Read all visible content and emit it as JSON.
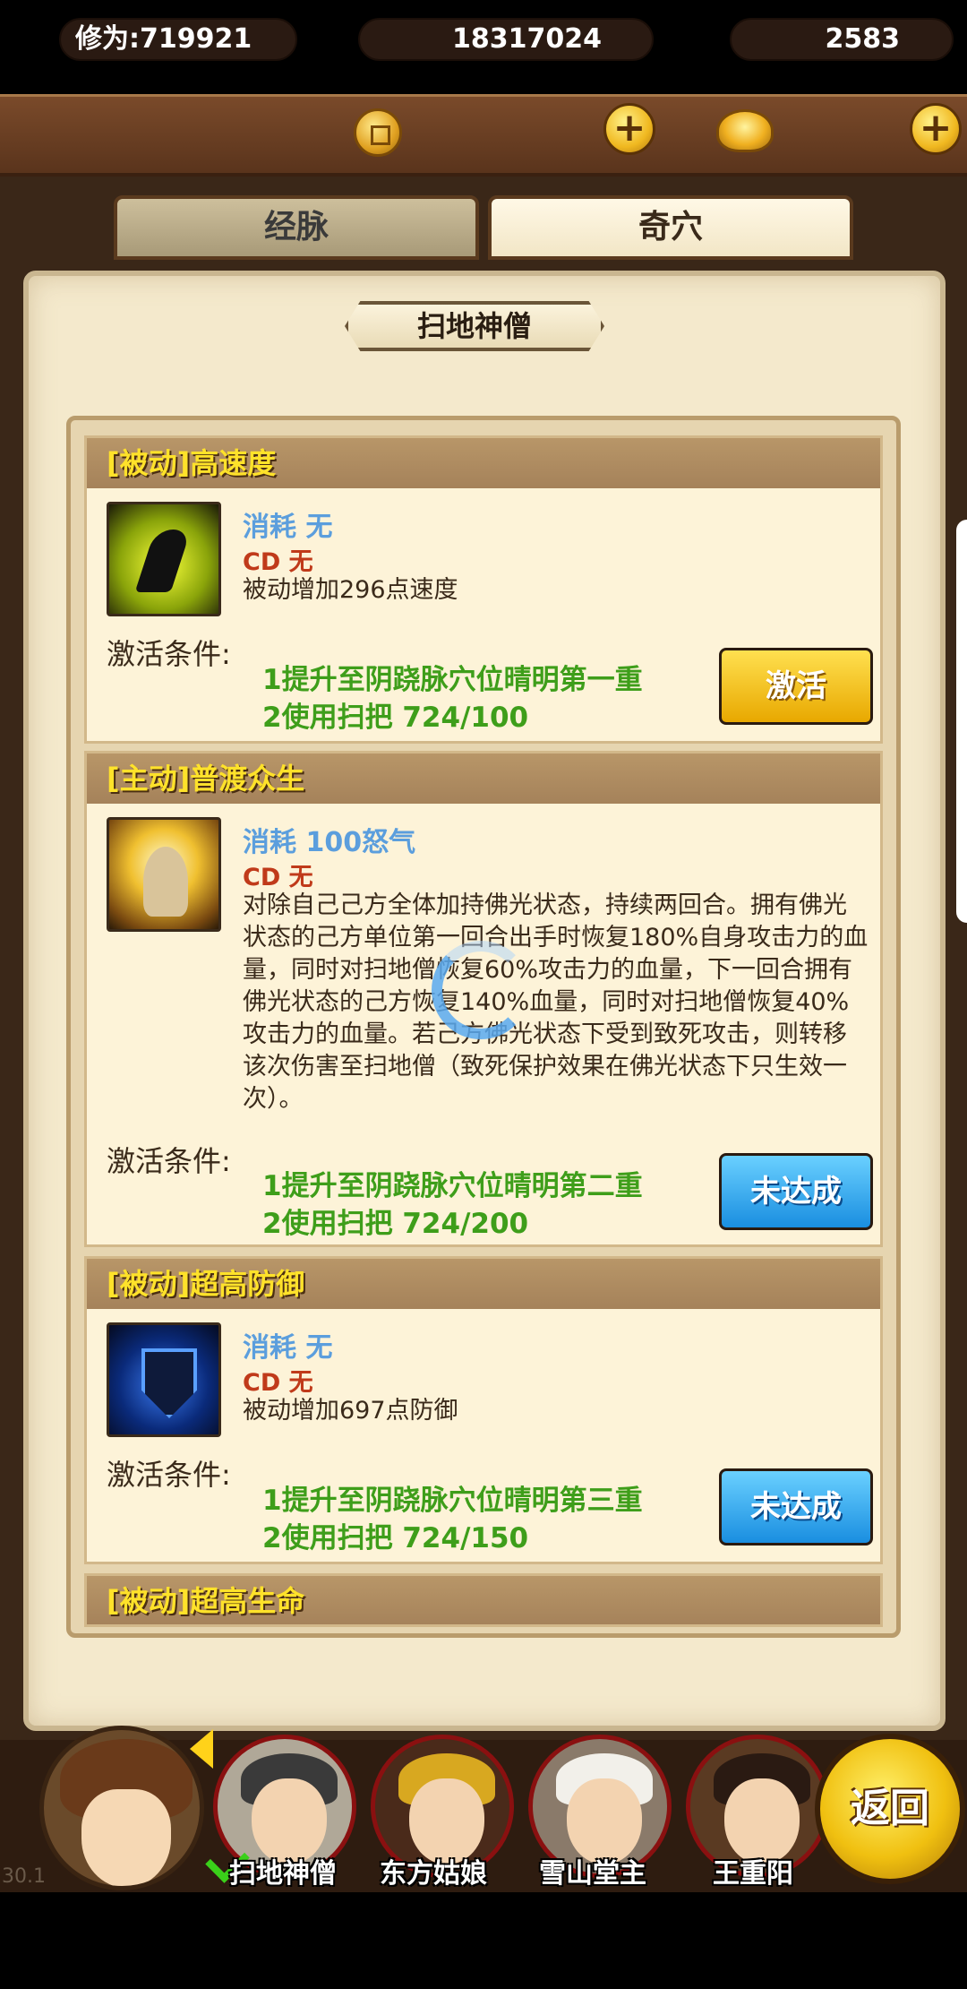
{
  "resources": {
    "cultivation": "修为:719921",
    "coins": "18317024",
    "gold": "2583",
    "plus": "+"
  },
  "tabs": {
    "meridian": "经脉",
    "acupoint": "奇穴"
  },
  "hero_title": "扫地神僧",
  "skills": [
    {
      "header": "[被动]高速度",
      "cost": "消耗 无",
      "cd": "CD   无",
      "desc": "被动增加296点速度",
      "activate_label": "激活条件:",
      "cond1": "1提升至阴跷脉穴位晴明第一重",
      "cond2": "2使用扫把 724/100",
      "button": "激活"
    },
    {
      "header": "[主动]普渡众生",
      "cost": "消耗 100怒气",
      "cd": "CD   无",
      "desc": "对除自己己方全体加持佛光状态，持续两回合。拥有佛光状态的己方单位第一回合出手时恢复180%自身攻击力的血量，同时对扫地僧恢复60%攻击力的血量，下一回合拥有佛光状态的己方恢复140%血量，同时对扫地僧恢复40%攻击力的血量。若己方佛光状态下受到致死攻击，则转移该次伤害至扫地僧（致死保护效果在佛光状态下只生效一次）。",
      "activate_label": "激活条件:",
      "cond1": "1提升至阴跷脉穴位晴明第二重",
      "cond2": "2使用扫把 724/200",
      "button": "未达成"
    },
    {
      "header": "[被动]超高防御",
      "cost": "消耗 无",
      "cd": "CD   无",
      "desc": "被动增加697点防御",
      "activate_label": "激活条件:",
      "cond1": "1提升至阴跷脉穴位晴明第三重",
      "cond2": "2使用扫把 724/150",
      "button": "未达成"
    },
    {
      "header": "[被动]超高生命"
    }
  ],
  "heroes": [
    "扫地神僧",
    "东方姑娘",
    "雪山堂主",
    "王重阳"
  ],
  "back_button": "返回",
  "corner_text": "30.1",
  "icons": {
    "coin": "coin-icon",
    "ingot": "gold-ingot-icon",
    "plus": "plus-icon",
    "skill1": "running-figure-icon",
    "skill2": "buddha-light-icon",
    "skill3": "shield-icon",
    "loading": "loading-spinner-icon",
    "check": "check-icon"
  }
}
